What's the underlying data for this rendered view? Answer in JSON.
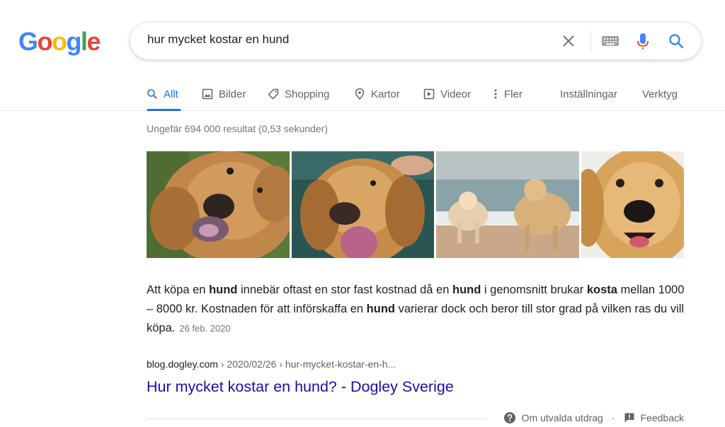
{
  "logo": {
    "letters": [
      "G",
      "o",
      "o",
      "g",
      "l",
      "e"
    ],
    "colors": [
      "#4285f4",
      "#ea4335",
      "#fbbc05",
      "#4285f4",
      "#34a853",
      "#ea4335"
    ]
  },
  "search": {
    "query": "hur mycket kostar en hund"
  },
  "tabs": [
    {
      "label": "Allt",
      "icon": "search-icon",
      "active": true
    },
    {
      "label": "Bilder",
      "icon": "image-icon"
    },
    {
      "label": "Shopping",
      "icon": "tag-icon"
    },
    {
      "label": "Kartor",
      "icon": "map-pin-icon"
    },
    {
      "label": "Videor",
      "icon": "video-icon"
    },
    {
      "label": "Fler",
      "icon": "more-vert-icon"
    }
  ],
  "tools": {
    "settings": "Inställningar",
    "tools": "Verktyg"
  },
  "result_stats": "Ungefär 694 000 resultat (0,53 sekunder)",
  "images": [
    "golden-retriever-tilted-head",
    "golden-retriever-tongue-out",
    "two-dogs-on-beach",
    "golden-retriever-face"
  ],
  "snippet": {
    "p1": "Att köpa en ",
    "b1": "hund",
    "p2": " innebär oftast en stor fast kostnad då en ",
    "b2": "hund",
    "p3": " i genomsnitt brukar ",
    "b3": "kosta",
    "p4": " mellan 1000 – 8000 kr. Kostnaden för att införskaffa en ",
    "b4": "hund",
    "p5": " varierar dock och beror till stor grad på vilken ras du vill köpa.",
    "date": "26 feb. 2020"
  },
  "cite": {
    "domain": "blog.dogley.com",
    "path": " › 2020/02/26 › hur-mycket-kostar-en-h..."
  },
  "result_title": "Hur mycket kostar en hund? - Dogley Sverige",
  "footer": {
    "about": "Om utvalda utdrag",
    "separator": "·",
    "feedback": "Feedback"
  },
  "colors": {
    "accent": "#1a73e8",
    "link": "#1a0dab",
    "muted": "#70757a"
  }
}
